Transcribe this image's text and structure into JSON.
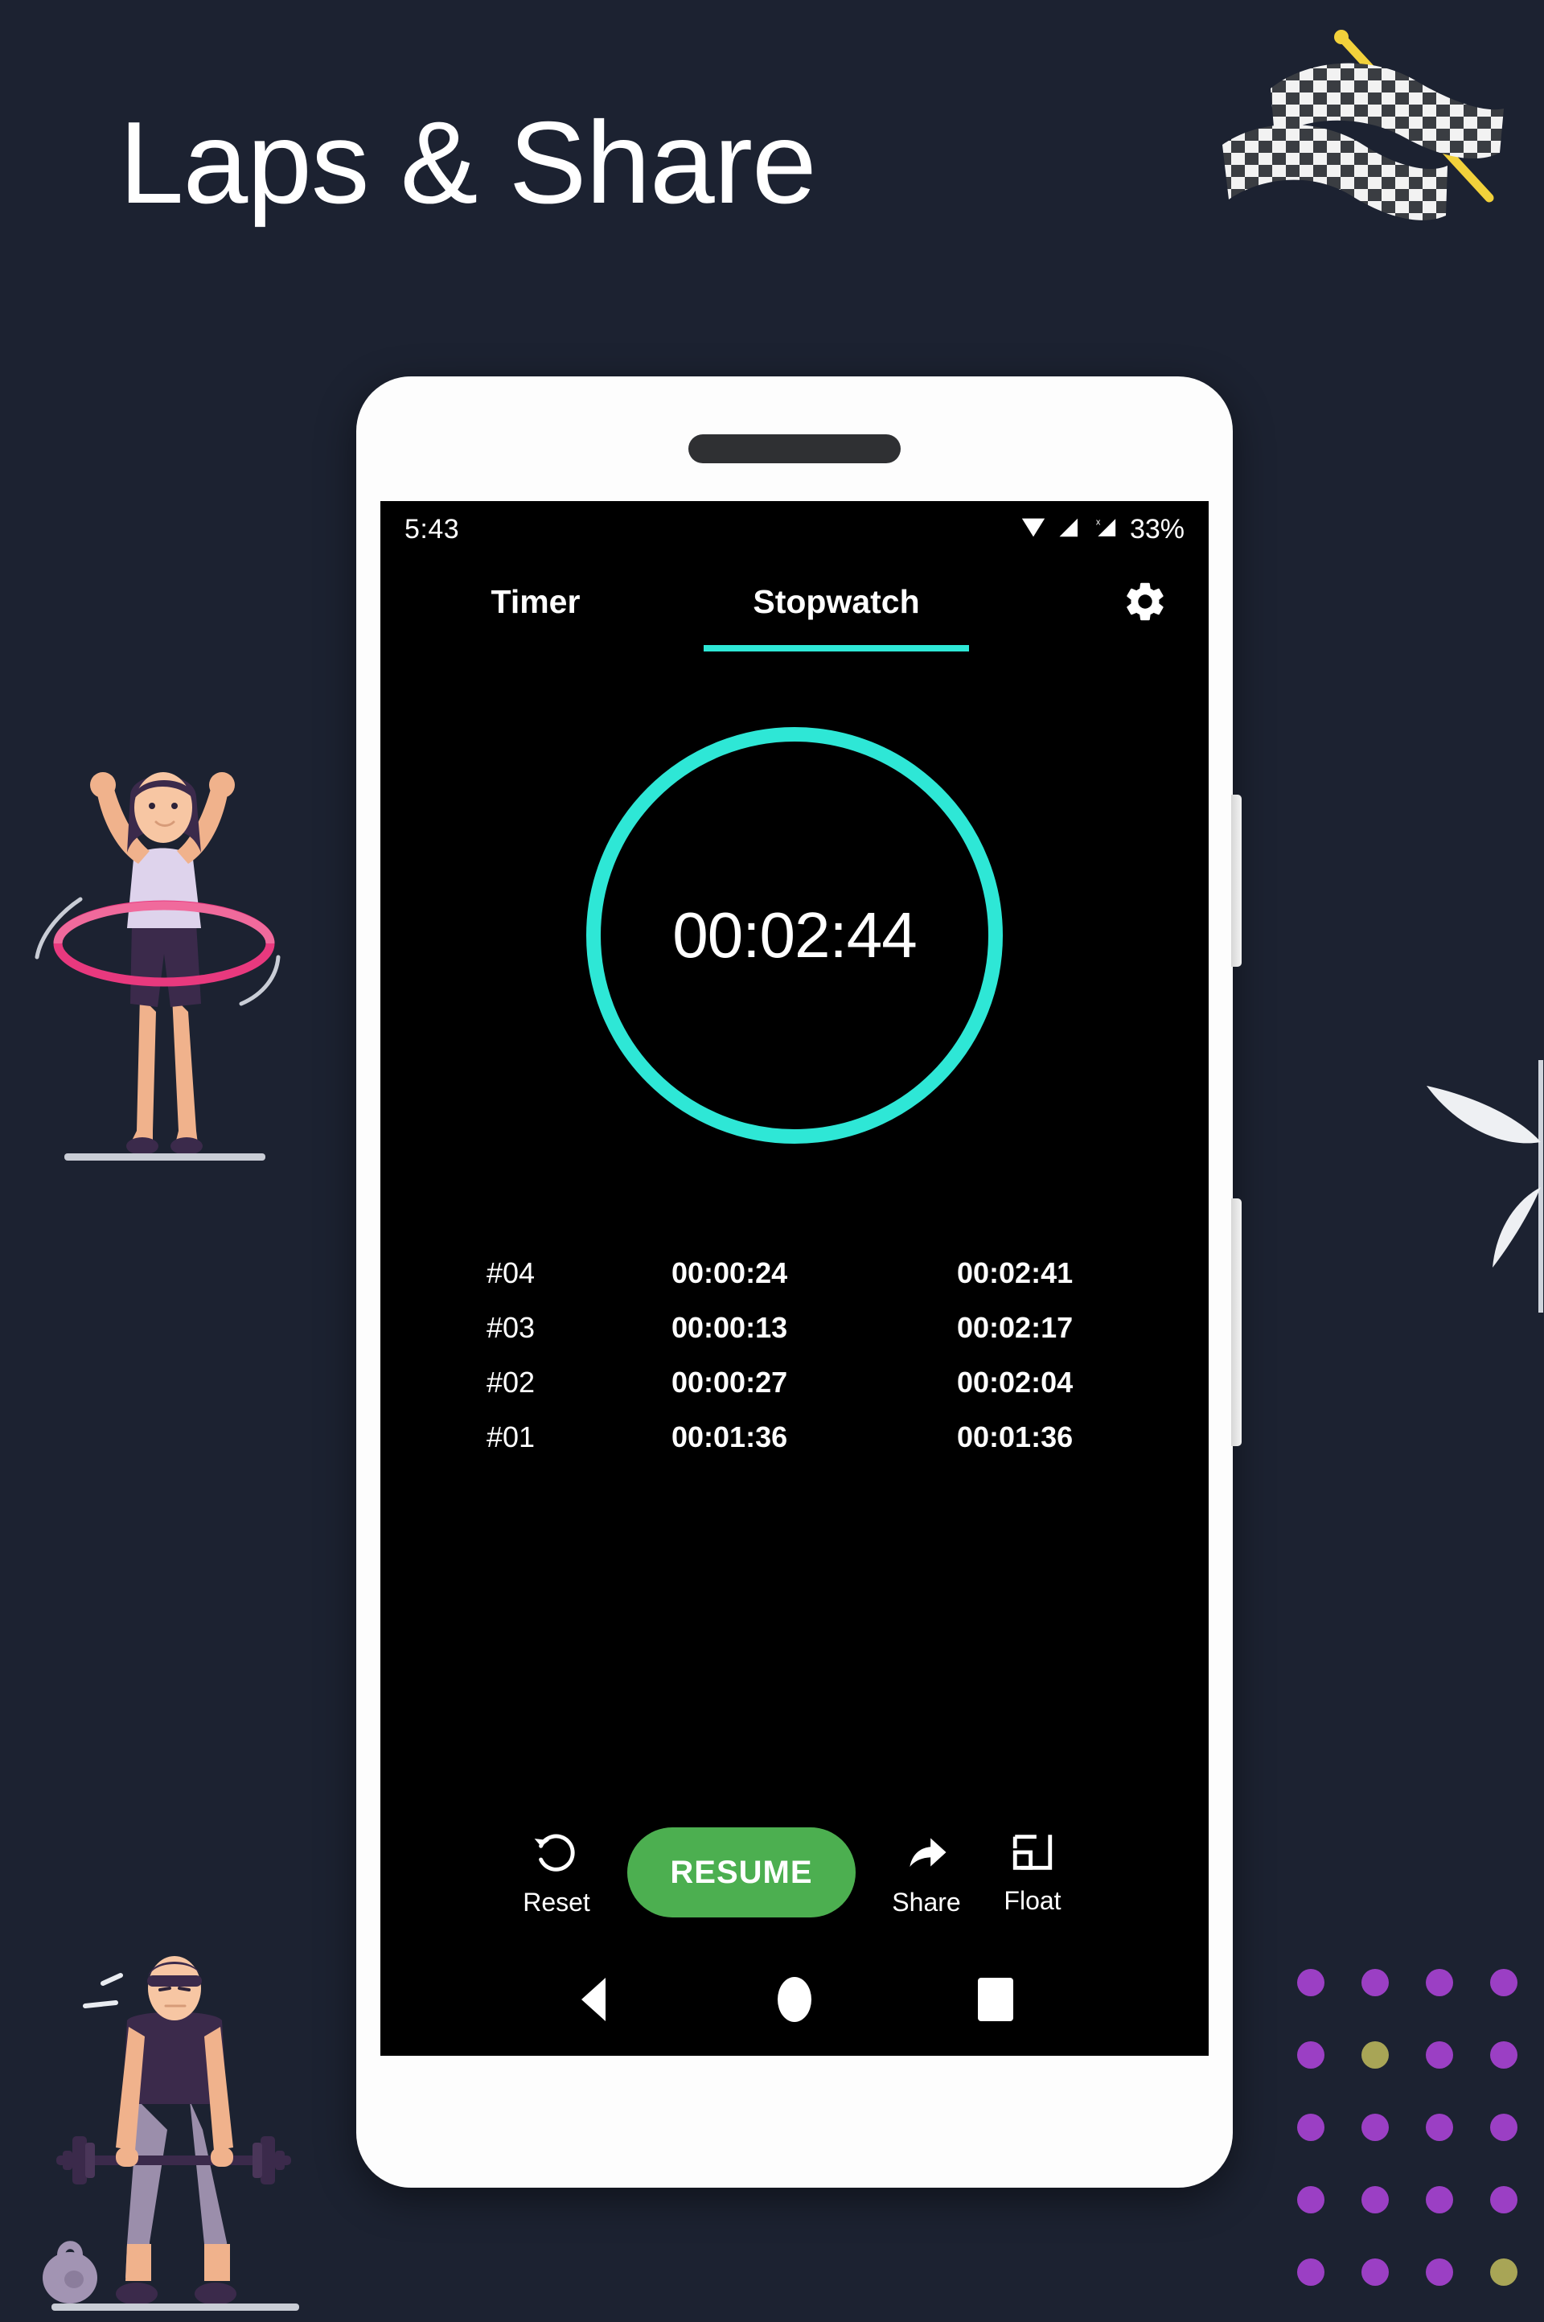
{
  "page": {
    "headline": "Laps & Share",
    "background_color": "#1c2231",
    "flag_icon": "checkered-flag-icon"
  },
  "phone": {
    "frame_color": "#fdfdfd",
    "screen_color": "#000000"
  },
  "status_bar": {
    "time": "5:43",
    "icons": [
      "wifi-icon",
      "signal-icon",
      "signal-no-sim-icon"
    ],
    "battery": "33%"
  },
  "tabs": {
    "items": [
      {
        "label": "Timer",
        "active": false
      },
      {
        "label": "Stopwatch",
        "active": true
      }
    ],
    "active_color": "#2ee7d6",
    "settings_icon": "gear-icon"
  },
  "stopwatch": {
    "elapsed": "00:02:44",
    "ring_color": "#2ee7d6"
  },
  "laps": {
    "columns": [
      "lap",
      "split",
      "total"
    ],
    "rows": [
      {
        "lap": "#04",
        "split": "00:00:24",
        "total": "00:02:41"
      },
      {
        "lap": "#03",
        "split": "00:00:13",
        "total": "00:02:17"
      },
      {
        "lap": "#02",
        "split": "00:00:27",
        "total": "00:02:04"
      },
      {
        "lap": "#01",
        "split": "00:01:36",
        "total": "00:01:36"
      }
    ]
  },
  "controls": {
    "reset_label": "Reset",
    "reset_icon": "rotate-left-icon",
    "resume_label": "RESUME",
    "resume_color": "#4caf50",
    "share_label": "Share",
    "share_icon": "share-arrow-icon",
    "float_label": "Float",
    "float_icon": "picture-in-picture-icon"
  },
  "nav_bar": {
    "back": "back-triangle-icon",
    "home": "home-circle-icon",
    "recents": "recents-square-icon"
  },
  "decor": {
    "left_illustration": "hula-hoop-woman-illustration",
    "bottom_left_illustration": "weightlifter-man-illustration",
    "right_leaf": "leaf-sprig-decoration",
    "dot_grid": {
      "rows": 5,
      "cols": 4,
      "primary_color": "#9b3fc4",
      "accent_color": "#a8a556",
      "accent_cells": [
        [
          1,
          1
        ],
        [
          4,
          3
        ]
      ]
    }
  }
}
